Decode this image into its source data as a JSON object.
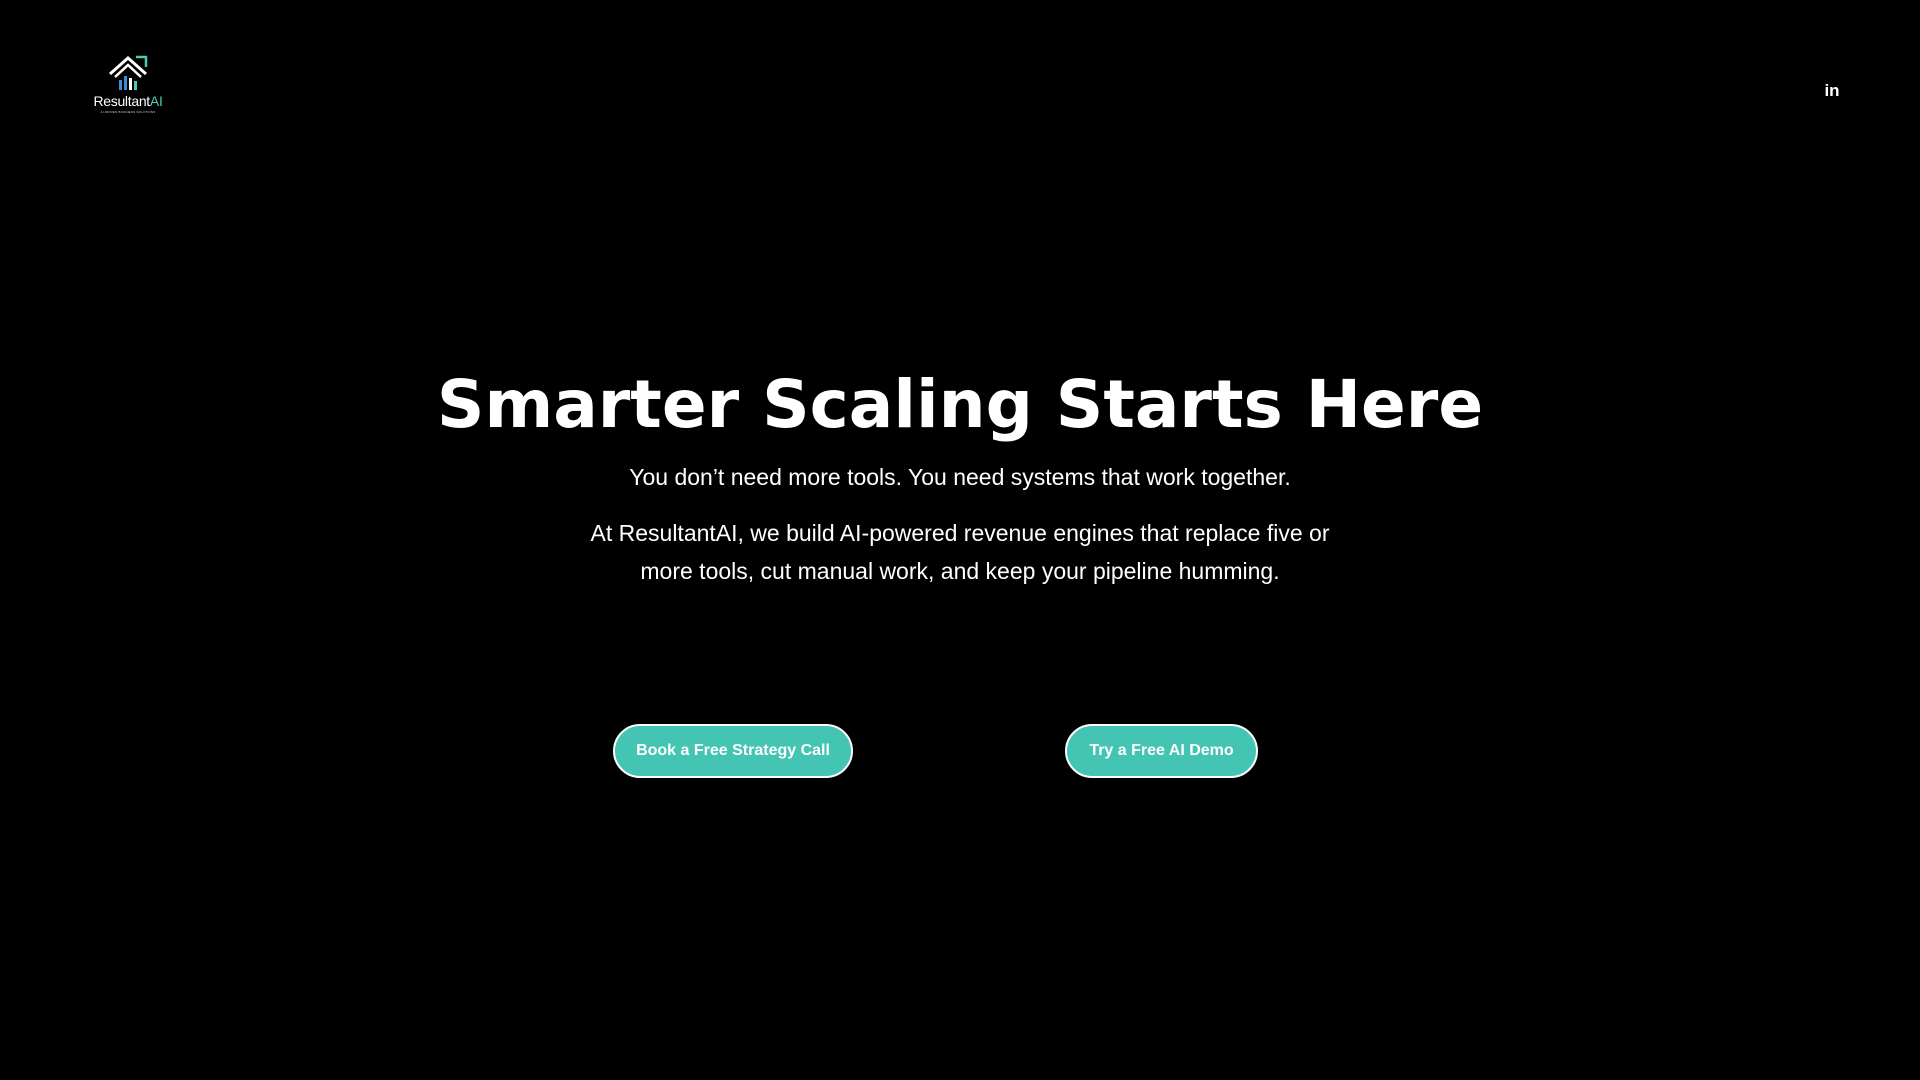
{
  "header": {
    "logo": {
      "name_part1": "Resultant",
      "name_part2": "AI",
      "tagline": "AI-DRIVEN BUSINESS SOLUTIONS",
      "icon": "house-chart-logo-icon"
    },
    "social": {
      "linkedin_label": "in",
      "icon": "linkedin-icon"
    }
  },
  "hero": {
    "title": "Smarter Scaling Starts Here",
    "subtitle": "You don’t need more tools. You need systems that work together.",
    "body": "At ResultantAI, we build AI-powered revenue engines that replace five or more tools, cut manual work, and keep your pipeline humming."
  },
  "cta": {
    "primary_label": "Book a Free Strategy Call",
    "secondary_label": "Try a Free AI Demo"
  },
  "colors": {
    "background": "#000000",
    "text": "#ffffff",
    "accent": "#44c4b2",
    "logo_accent": "#4fc9b4",
    "logo_blue": "#3a8fd8"
  }
}
